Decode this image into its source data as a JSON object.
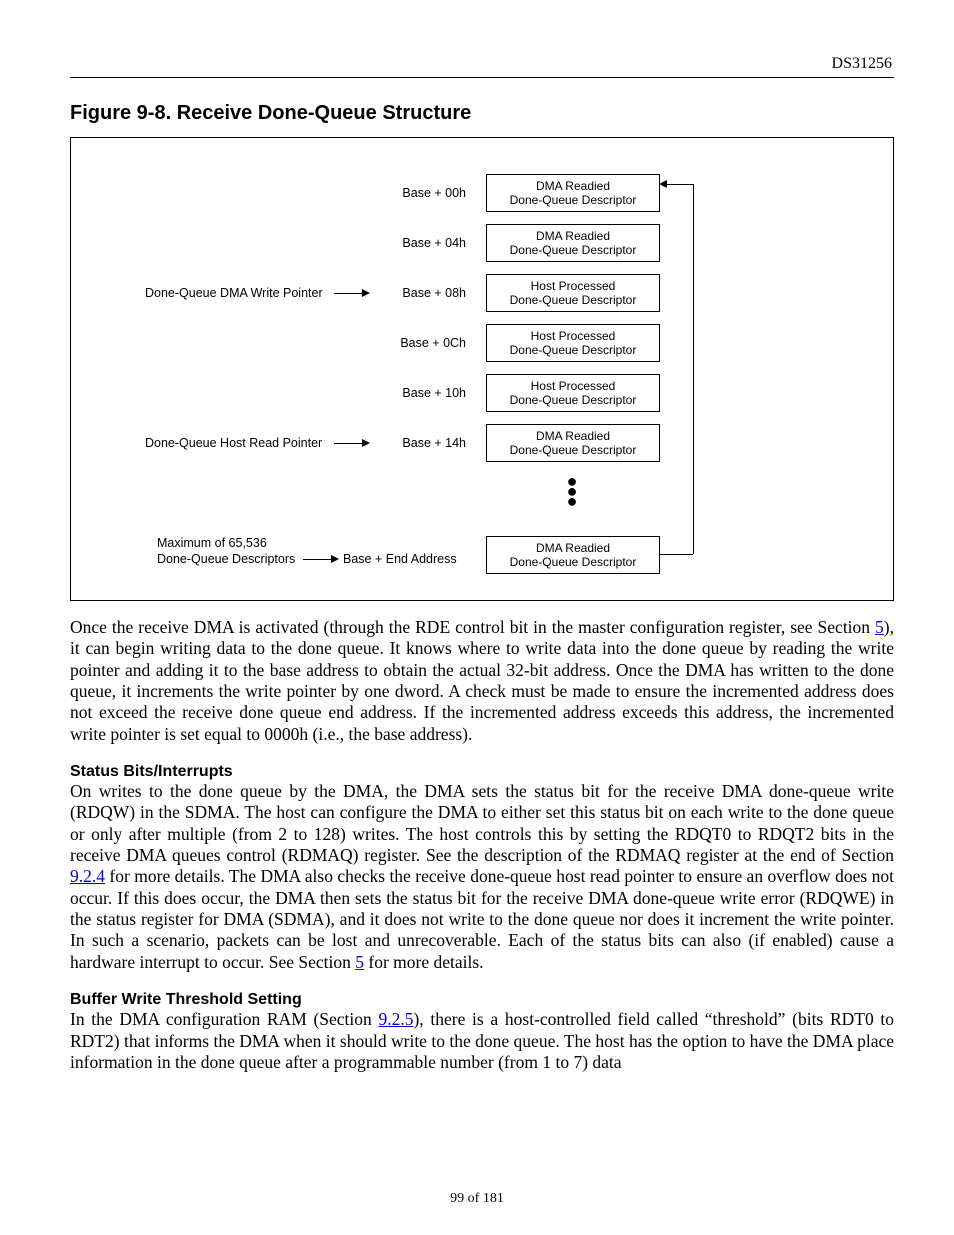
{
  "doc_id": "DS31256",
  "figure": {
    "title": "Figure 9-8. Receive Done-Queue Structure",
    "labels": {
      "dma_write_ptr": "Done-Queue DMA Write Pointer",
      "host_read_ptr": "Done-Queue Host Read Pointer",
      "max_line1": "Maximum of 65,536",
      "max_line2": "Done-Queue Descriptors",
      "base_end": "Base + End Address"
    },
    "offsets": [
      "Base + 00h",
      "Base + 04h",
      "Base + 08h",
      "Base + 0Ch",
      "Base + 10h",
      "Base + 14h"
    ],
    "rows": [
      {
        "l1": "DMA Readied",
        "l2": "Done-Queue Descriptor"
      },
      {
        "l1": "DMA Readied",
        "l2": "Done-Queue Descriptor"
      },
      {
        "l1": "Host Processed",
        "l2": "Done-Queue Descriptor"
      },
      {
        "l1": "Host Processed",
        "l2": "Done-Queue Descriptor"
      },
      {
        "l1": "Host Processed",
        "l2": "Done-Queue Descriptor"
      },
      {
        "l1": "DMA Readied",
        "l2": "Done-Queue Descriptor"
      }
    ],
    "last": {
      "l1": "DMA Readied",
      "l2": "Done-Queue Descriptor"
    }
  },
  "para1_a": "Once the receive DMA is activated (through the RDE control bit in the master configuration register, see Section ",
  "link5a": "5",
  "para1_b": "), it can begin writing data to the done queue. It knows where to write data into the done queue by reading the write pointer and adding it to the base address to obtain the actual 32-bit address. Once the DMA has written to the done queue, it increments the write pointer by one dword. A check must be made to ensure the incremented address does not exceed the receive done queue end address. If the incremented address exceeds this address, the incremented write pointer is set equal to 0000h (i.e., the base address).",
  "heading_status": "Status Bits/Interrupts",
  "para2_a": "On writes to the done queue by the DMA, the DMA sets the status bit for the receive DMA done-queue write (RDQW) in the SDMA. The host can configure the DMA to either set this status bit on each write to the done queue or only after multiple (from 2 to 128) writes. The host controls this by setting the RDQT0 to RDQT2 bits in the receive DMA queues control (RDMAQ) register. See the description of the RDMAQ register at the end of Section ",
  "link924": "9.2.4",
  "para2_b": " for more details. The DMA also checks the receive done-queue host read pointer to ensure an overflow does not occur. If this does occur, the DMA then sets the status bit for the receive DMA done-queue write error (RDQWE) in the status register for DMA (SDMA), and it does not write to the done queue nor does it increment the write pointer. In such a scenario, packets can be lost and unrecoverable. Each of the status bits can also (if enabled) cause a hardware interrupt to occur. See Section ",
  "link5b": "5",
  "para2_c": " for more details.",
  "heading_buffer": "Buffer Write Threshold Setting",
  "para3_a": "In the DMA configuration RAM (Section ",
  "link925": "9.2.5",
  "para3_b": "), there is a host-controlled field called “threshold” (bits RDT0 to RDT2) that informs the DMA when it should write to the done queue. The host has the option to have the DMA place information in the done queue after a programmable number (from 1 to 7) data",
  "pagenum": "99 of 181"
}
